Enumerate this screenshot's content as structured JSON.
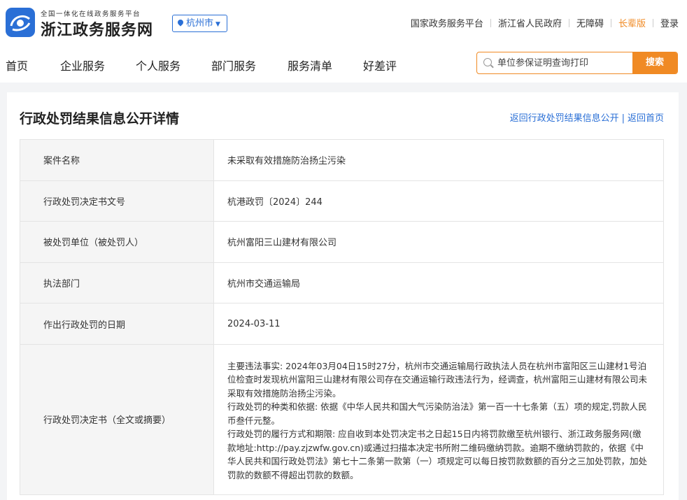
{
  "header": {
    "subtitle": "全国一体化在线政务服务平台",
    "site_name": "浙江政务服务网",
    "city": "杭州市",
    "top_links": [
      "国家政务服务平台",
      "浙江省人民政府",
      "无障碍",
      "长辈版",
      "登录"
    ],
    "colors": {
      "brand_blue": "#2a6fd6",
      "accent_orange": "#f08a24"
    }
  },
  "nav": {
    "items": [
      "首页",
      "企业服务",
      "个人服务",
      "部门服务",
      "服务清单",
      "好差评"
    ],
    "search": {
      "placeholder": "单位参保证明查询打印",
      "button": "搜索"
    }
  },
  "main": {
    "title": "行政处罚结果信息公开详情",
    "back_link_list": "返回行政处罚结果信息公开",
    "back_link_home": "返回首页",
    "rows": [
      {
        "label": "案件名称",
        "value": "未采取有效措施防治扬尘污染"
      },
      {
        "label": "行政处罚决定书文号",
        "value": "杭港政罚〔2024〕244"
      },
      {
        "label": "被处罚单位（被处罚人）",
        "value": "杭州富阳三山建材有限公司"
      },
      {
        "label": "执法部门",
        "value": "杭州市交通运输局"
      },
      {
        "label": "作出行政处罚的日期",
        "value": "2024-03-11"
      }
    ],
    "decision": {
      "label": "行政处罚决定书（全文或摘要）",
      "paragraphs": [
        "主要违法事实: 2024年03月04日15时27分，杭州市交通运输局行政执法人员在杭州市富阳区三山建材1号泊位检查时发现杭州富阳三山建材有限公司存在交通运输行政违法行为，经调查，杭州富阳三山建材有限公司未采取有效措施防治扬尘污染。",
        "行政处罚的种类和依据: 依据《中华人民共和国大气污染防治法》第一百一十七条第（五）项的规定,罚款人民币叁仟元整。",
        "行政处罚的履行方式和期限: 应自收到本处罚决定书之日起15日内将罚款缴至杭州银行、浙江政务服务网(缴款地址:http://pay.zjzwfw.gov.cn)或通过扫描本决定书所附二维码缴纳罚款。逾期不缴纳罚款的，依据《中华人民共和国行政处罚法》第七十二条第一款第（一）项规定可以每日按罚款数额的百分之三加处罚款，加处罚款的数额不得超出罚款的数额。"
      ]
    }
  }
}
